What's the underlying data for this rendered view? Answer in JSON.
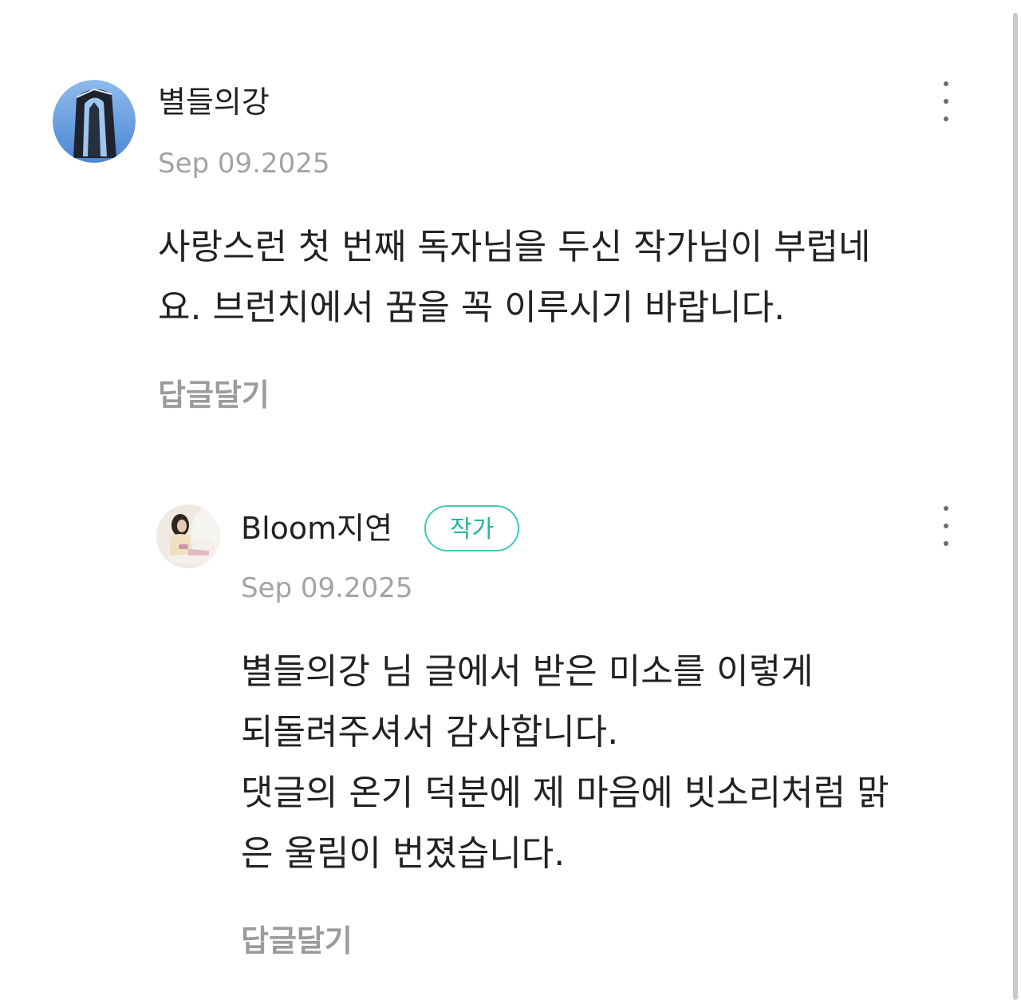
{
  "comment": {
    "author": "별들의강",
    "date": "Sep 09.2025",
    "text_lines": [
      "사랑스런 첫 번째 독자님을 두신 작가님이 부럽네",
      "요. 브런치에서 꿈을 꼭 이루시기 바랍니다."
    ],
    "reply_label": "답글달기",
    "avatar_icon": "building-profile-icon",
    "menu_icon": "more-vertical-icon"
  },
  "reply": {
    "author": "Bloom지연",
    "badge": "작가",
    "date": "Sep 09.2025",
    "text_lines": [
      "별들의강 님 글에서 받은 미소를 이렇게",
      "되돌려주셔서 감사합니다.",
      "댓글의 온기 덕분에 제 마음에 빗소리처럼 맑",
      "은 울림이 번졌습니다."
    ],
    "reply_label": "답글달기",
    "avatar_icon": "person-photo-avatar",
    "menu_icon": "more-vertical-icon"
  },
  "colors": {
    "text": "#222222",
    "muted": "#a3a3a3",
    "badge": "#3cc9b9"
  }
}
